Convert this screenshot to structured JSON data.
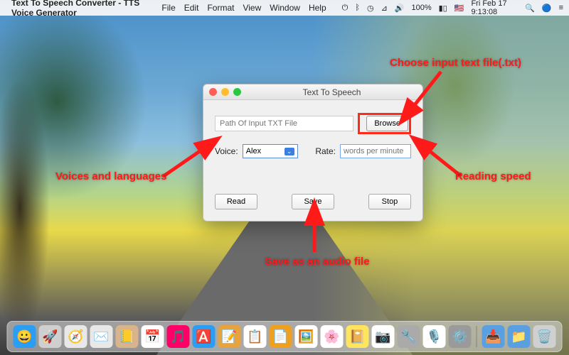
{
  "menubar": {
    "app_name": "Text To Speech Converter - TTS Voice Generator",
    "items": [
      "File",
      "Edit",
      "Format",
      "View",
      "Window",
      "Help"
    ],
    "battery": "100%",
    "clock": "Fri Feb 17  9:13:08"
  },
  "window": {
    "title": "Text To Speech",
    "path_placeholder": "Path Of Input TXT File",
    "browse": "Browse",
    "voice_label": "Voice:",
    "voice_value": "Alex",
    "rate_label": "Rate:",
    "rate_placeholder": "words per minute",
    "read": "Read",
    "save": "Save",
    "stop": "Stop"
  },
  "callouts": {
    "browse": "Choose input text file(.txt)",
    "voice": "Voices and languages",
    "rate": "Reading speed",
    "save": "Save as an audio file"
  },
  "dock": {
    "apps": [
      {
        "name": "finder",
        "color": "#2a9df4",
        "glyph": "😀"
      },
      {
        "name": "launchpad",
        "color": "#cfcfcf",
        "glyph": "🚀"
      },
      {
        "name": "safari",
        "color": "#e8e8e8",
        "glyph": "🧭"
      },
      {
        "name": "mail",
        "color": "#e8e8e8",
        "glyph": "✉️"
      },
      {
        "name": "contacts",
        "color": "#d9b38c",
        "glyph": "📒"
      },
      {
        "name": "calendar",
        "color": "#fff",
        "glyph": "📅"
      },
      {
        "name": "itunes",
        "color": "#f06",
        "glyph": "🎵"
      },
      {
        "name": "appstore",
        "color": "#2a9df4",
        "glyph": "🅰️"
      },
      {
        "name": "notes",
        "color": "#e8a33d",
        "glyph": "📝"
      },
      {
        "name": "reminders",
        "color": "#fff",
        "glyph": "📋"
      },
      {
        "name": "pages",
        "color": "#f0a020",
        "glyph": "📄"
      },
      {
        "name": "preview",
        "color": "#fff",
        "glyph": "🖼️"
      },
      {
        "name": "photos",
        "color": "#fff",
        "glyph": "🌸"
      },
      {
        "name": "stickies",
        "color": "#ffe45e",
        "glyph": "📔"
      },
      {
        "name": "screenshot",
        "color": "#fff",
        "glyph": "📷"
      },
      {
        "name": "tool",
        "color": "#aaa",
        "glyph": "🔧"
      },
      {
        "name": "dictation",
        "color": "#fff",
        "glyph": "🎙️"
      },
      {
        "name": "preferences",
        "color": "#9a9a9a",
        "glyph": "⚙️"
      }
    ],
    "right": [
      {
        "name": "downloads",
        "color": "#5aa0e0",
        "glyph": "📥"
      },
      {
        "name": "folder",
        "color": "#5aa0e0",
        "glyph": "📁"
      },
      {
        "name": "trash",
        "color": "#d0d0d0",
        "glyph": "🗑️"
      }
    ]
  }
}
